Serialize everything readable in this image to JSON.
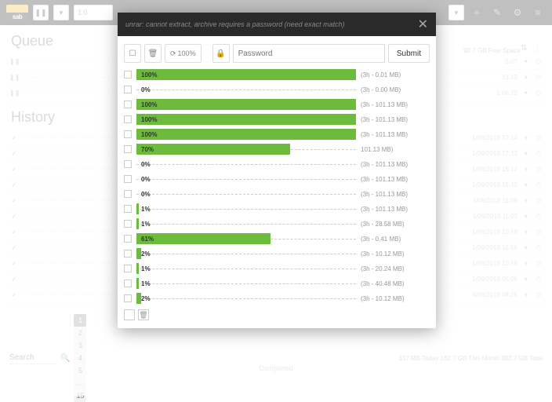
{
  "topbar": {
    "logo_text": "sab",
    "pause": "❚❚",
    "speed": "1.0",
    "plus": "+",
    "gear": "⚙",
    "wrench": "✎",
    "menu": "≡"
  },
  "queue_title": "Queue",
  "history_title": "History",
  "free_space": "90.7 GB Free Space",
  "queue_rows": [
    {
      "size": "5.07"
    },
    {
      "size": "13.19"
    },
    {
      "size": "1.06.22"
    }
  ],
  "history_rows": [
    {
      "date": "1/06/2018 17:14"
    },
    {
      "date": "1/06/2018 17:12"
    },
    {
      "date": "1/06/2018 15:12"
    },
    {
      "date": "1/06/2018 15:10"
    },
    {
      "date": "1/06/2018 11:09"
    },
    {
      "date": "1/06/2018 11:07"
    },
    {
      "date": "1/06/2018 10:58"
    },
    {
      "date": "1/06/2018 10:56"
    },
    {
      "date": "1/06/2018 10:56"
    },
    {
      "date": "1/06/2018 05:06"
    },
    {
      "date": "4/06/2018 08:25"
    }
  ],
  "pagination": {
    "search": "Search",
    "pages": [
      "1",
      "2",
      "3",
      "4",
      "5",
      "…",
      "15"
    ],
    "footer": "337 MB Today   182.7 GB This Month   382.7 GB Total"
  },
  "completed_text": "Completed",
  "modal": {
    "header_text": "unrar: cannot extract, archive requires a password (need exact match)",
    "pct100_label": "100%",
    "password_placeholder": "Password",
    "submit_label": "Submit",
    "items": [
      {
        "pct": 100,
        "label": "100%",
        "info": "(3h - 0.01 MB)"
      },
      {
        "pct": 0,
        "label": "0%",
        "info": "(3h - 0.00 MB)"
      },
      {
        "pct": 100,
        "label": "100%",
        "info": "(3h - 101.13 MB)"
      },
      {
        "pct": 100,
        "label": "100%",
        "info": "(3h - 101.13 MB)"
      },
      {
        "pct": 100,
        "label": "100%",
        "info": "(3h - 101.13 MB)"
      },
      {
        "pct": 70,
        "label": "70%",
        "info": "101.13 MB)"
      },
      {
        "pct": 0,
        "label": "0%",
        "info": "(3h - 101.13 MB)"
      },
      {
        "pct": 0,
        "label": "0%",
        "info": "(3h - 101.13 MB)"
      },
      {
        "pct": 0,
        "label": "0%",
        "info": "(3h - 101.13 MB)"
      },
      {
        "pct": 1,
        "label": "1%",
        "info": "(3h - 101.13 MB)"
      },
      {
        "pct": 1,
        "label": "1%",
        "info": "(3h - 28.58 MB)"
      },
      {
        "pct": 61,
        "label": "61%",
        "info": "(3h - 0.41 MB)"
      },
      {
        "pct": 2,
        "label": "2%",
        "info": "(3h - 10.12 MB)"
      },
      {
        "pct": 1,
        "label": "1%",
        "info": "(3h - 20.24 MB)"
      },
      {
        "pct": 1,
        "label": "1%",
        "info": "(3h - 40.48 MB)"
      },
      {
        "pct": 2,
        "label": "2%",
        "info": "(3h - 10.12 MB)"
      }
    ]
  }
}
